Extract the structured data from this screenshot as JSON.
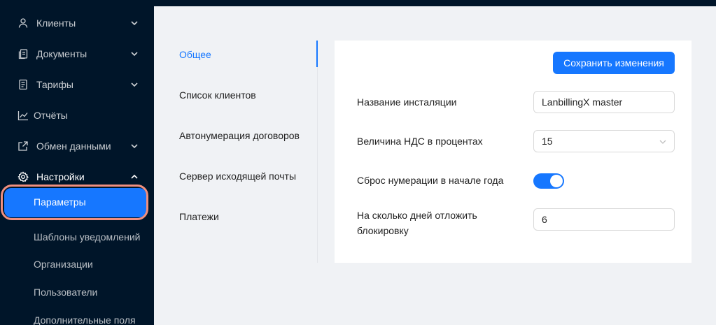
{
  "sidebar": {
    "items": [
      {
        "label": "Клиенты",
        "icon": "user-icon"
      },
      {
        "label": "Документы",
        "icon": "documents-icon"
      },
      {
        "label": "Тарифы",
        "icon": "tariffs-icon"
      },
      {
        "label": "Отчёты",
        "icon": "chart-icon"
      },
      {
        "label": "Обмен данными",
        "icon": "exchange-icon"
      },
      {
        "label": "Настройки",
        "icon": "gear-icon"
      }
    ],
    "sub_items": [
      {
        "label": "Параметры"
      },
      {
        "label": "Шаблоны уведомлений"
      },
      {
        "label": "Организации"
      },
      {
        "label": "Пользователи"
      },
      {
        "label": "Дополнительные поля"
      }
    ]
  },
  "tabs": [
    {
      "label": "Общее"
    },
    {
      "label": "Список клиентов"
    },
    {
      "label": "Автонумерация договоров"
    },
    {
      "label": "Сервер исходящей почты"
    },
    {
      "label": "Платежи"
    }
  ],
  "form": {
    "save_label": "Сохранить изменения",
    "install_name_label": "Название инсталяции",
    "install_name_value": "LanbillingX master",
    "vat_label": "Величина НДС в процентах",
    "vat_value": "15",
    "reset_label": "Сброс нумерации в начале года",
    "reset_on": true,
    "block_delay_label": "На сколько дней отложить блокировку",
    "block_delay_value": "6"
  },
  "colors": {
    "sidebar_bg": "#001529",
    "accent": "#1677ff",
    "highlight_ring": "#f08f7e",
    "page_bg": "#f0f2f5"
  }
}
